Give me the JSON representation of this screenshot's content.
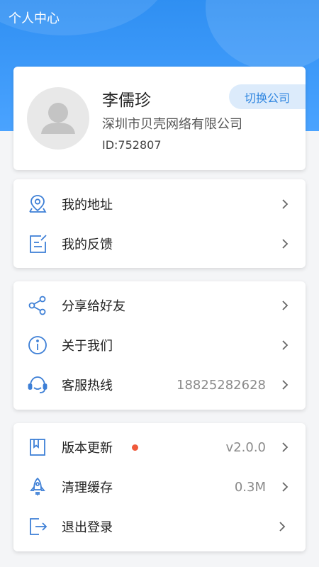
{
  "header": {
    "title": "个人中心"
  },
  "profile": {
    "name": "李儒珍",
    "company": "深圳市贝壳网络有限公司",
    "id": "ID:752807",
    "switch_label": "切换公司"
  },
  "group1": [
    {
      "label": "我的地址",
      "icon": "location-pin-icon"
    },
    {
      "label": "我的反馈",
      "icon": "feedback-icon"
    }
  ],
  "group2": [
    {
      "label": "分享给好友",
      "icon": "share-icon"
    },
    {
      "label": "关于我们",
      "icon": "info-icon"
    },
    {
      "label": "客服热线",
      "icon": "headset-icon",
      "value": "18825282628"
    }
  ],
  "group3": [
    {
      "label": "版本更新",
      "icon": "bookmark-icon",
      "value": "v2.0.0",
      "has_badge": true
    },
    {
      "label": "清理缓存",
      "icon": "rocket-icon",
      "value": "0.3M"
    },
    {
      "label": "退出登录",
      "icon": "logout-icon"
    }
  ],
  "colors": {
    "accent": "#2f8ff2",
    "icon_blue": "#3d7fd6",
    "badge_red": "#f05a3b"
  }
}
